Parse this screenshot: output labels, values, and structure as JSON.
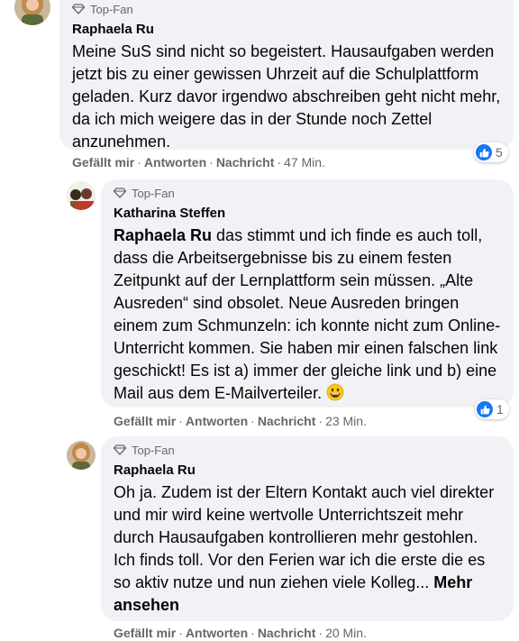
{
  "comments": [
    {
      "badge": "Top-Fan",
      "author": "Raphaela Ru",
      "text": "Meine SuS sind nicht so begeistert. Hausaufgaben werden jetzt bis zu einer gewissen Uhrzeit auf die Schulplattform geladen. Kurz davor irgendwo abschreiben geht nicht mehr, da ich mich weigere das in der Stunde noch Zettel anzunehmen.",
      "reaction_count": "5",
      "actions": {
        "like": "Gefällt mir",
        "reply": "Antworten",
        "message": "Nachricht",
        "time": "47 Min."
      }
    },
    {
      "badge": "Top-Fan",
      "author": "Katharina Steffen",
      "mention": "Raphaela Ru",
      "text": "das stimmt und ich finde es auch toll, dass die Arbeitsergebnisse bis zu einem festen Zeitpunkt auf der Lernplattform sein müssen. „Alte Ausreden“ sind obsolet. Neue Ausreden bringen einem zum Schmunzeln: ich konnte nicht zum Online-Unterricht kommen. Sie haben mir einen falschen link geschickt! Es ist a) immer der gleiche link und b) eine Mail aus dem E-Mailverteiler.",
      "emoji": "smiling-face-emoji",
      "reaction_count": "1",
      "actions": {
        "like": "Gefällt mir",
        "reply": "Antworten",
        "message": "Nachricht",
        "time": "23 Min."
      }
    },
    {
      "badge": "Top-Fan",
      "author": "Raphaela Ru",
      "text": "Oh ja. Zudem ist der Eltern Kontakt auch viel direkter und mir wird keine wertvolle Unterrichtszeit mehr durch Hausaufgaben kontrollieren mehr gestohlen. Ich finds toll. Vor den Ferien war ich die erste die es so aktiv nutze und nun ziehen viele Kolleg...",
      "more_label": "Mehr ansehen",
      "actions": {
        "like": "Gefällt mir",
        "reply": "Antworten",
        "message": "Nachricht",
        "time": "20 Min."
      }
    }
  ],
  "colors": {
    "bubble": "#f0f2f5",
    "like_blue": "#1877f2",
    "meta_gray": "#65676b"
  }
}
